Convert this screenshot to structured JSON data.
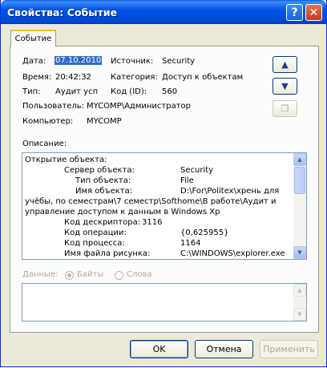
{
  "window": {
    "title": "Свойства: Событие",
    "help": "?",
    "close": "✕"
  },
  "tab": {
    "label": "Событие"
  },
  "fields": {
    "date_label": "Дата:",
    "date_value": "07.10.2010",
    "source_label": "Источник:",
    "source_value": "Security",
    "time_label": "Время:",
    "time_value": "20:42:32",
    "category_label": "Категория:",
    "category_value": "Доступ к объектам",
    "type_label": "Тип:",
    "type_value": "Аудит усп",
    "id_label": "Код (ID):",
    "id_value": "560",
    "user_label": "Пользователь:",
    "user_value": "MYCOMP\\Администратор",
    "computer_label": "Компьютер:",
    "computer_value": "MYCOMP"
  },
  "nav": {
    "up_icon": "arrow-up-icon",
    "down_icon": "arrow-down-icon",
    "copy_icon": "copy-icon"
  },
  "description": {
    "label": "Описание:",
    "lines": [
      "Открытие объекта:",
      "Сервер объекта:",
      "Security",
      "Тип объекта:",
      "File",
      "Имя объекта:",
      "D:\\For\\Politex\\хрень для",
      "учёбы, по семестрам\\7 семестр\\Softhome\\В работе\\Аудит и",
      "управление доступом к данным в Windows Xp",
      "Код дескриптора:",
      "3116",
      "Код операции:",
      "{0,625955}",
      "Код процесса:",
      "1164",
      "Имя файла рисунка:",
      "C:\\WINDOWS\\explorer.exe"
    ]
  },
  "data_section": {
    "label": "Данные:",
    "bytes": "Байты",
    "words": "Слова"
  },
  "buttons": {
    "ok": "OK",
    "cancel": "Отмена",
    "apply": "Применить"
  }
}
